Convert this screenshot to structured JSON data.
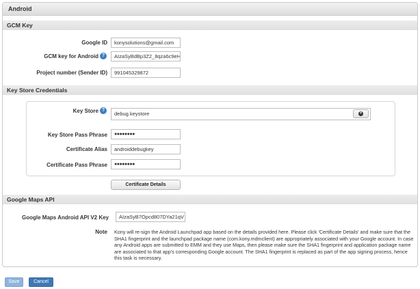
{
  "panel": {
    "title": "Android"
  },
  "gcm": {
    "section_title": "GCM Key",
    "google_id_label": "Google ID",
    "google_id_value": "konysolutions@gmail.com",
    "gcm_key_label": "GCM key for Android",
    "gcm_key_value": "AIzaSyBdBp3Z2_8qza6c9eH",
    "project_number_label": "Project number (Sender ID)",
    "project_number_value": "991045329872"
  },
  "keystore": {
    "section_title": "Key Store Credentials",
    "key_store_label": "Key Store",
    "key_store_value": "debug.keystore",
    "pass_phrase_label": "Key Store Pass Phrase",
    "pass_phrase_value": "●●●●●●●●",
    "alias_label": "Certificate Alias",
    "alias_value": "androiddebugkey",
    "cert_pass_label": "Certificate Pass Phrase",
    "cert_pass_value": "●●●●●●●●",
    "details_button": "Certificate Details"
  },
  "maps": {
    "section_title": "Google Maps API",
    "api_key_label": "Google Maps Android API V2 Key",
    "api_key_value": "AIzaSyB7Opcd807DYa21qV",
    "note_label": "Note",
    "note_text": "Kony will re-sign the Android Launchpad app based on the details provided here. Please click 'Certificate Details' and make sure that the SHA1 fingerprint and the launchpad package name (com.kony.mdmclient) are appropriately associated with your Google account. In case any Android apps are submitted to EMM and they use Maps, then please make sure the SHA1 fingerprint and application package name are associated to that app's corresponding Google account. The SHA1 fingerprint is replaced as part of the app signing process, hence this task is necessary."
  },
  "footer": {
    "save_label": "Save",
    "cancel_label": "Cancel"
  },
  "icons": {
    "help": "help-circle-icon",
    "remove": "close-icon"
  },
  "colors": {
    "accent": "#3d7fc4",
    "save_bg": "#8fb4dd",
    "cancel_bg": "#3f78b5"
  }
}
